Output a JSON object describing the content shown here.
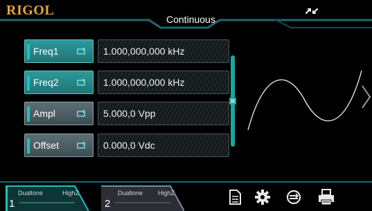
{
  "header": {
    "logo": "RIGOL",
    "mode": "Continuous",
    "sync_icon": "link-sync-icon"
  },
  "params": [
    {
      "label": "Freq1",
      "value": "1.000,000,000 kHz",
      "active": true
    },
    {
      "label": "Freq2",
      "value": "1.000,000,000 kHz",
      "active": true
    },
    {
      "label": "Ampl",
      "value": "5.000,0 Vpp",
      "active": false
    },
    {
      "label": "Offset",
      "value": "0.000,0 Vdc",
      "active": false
    }
  ],
  "channels": [
    {
      "number": "1",
      "mode": "Dualtone",
      "impedance": "HighZ",
      "color": "#1ec4c0"
    },
    {
      "number": "2",
      "mode": "Dualtone",
      "impedance": "HighZ",
      "color": "#7f8aa0"
    }
  ],
  "toolbar": {
    "icons": [
      "document-icon",
      "gear-icon",
      "sync-icon",
      "printer-icon"
    ]
  },
  "colors": {
    "accent": "#1ec4c0",
    "logo": "#e8a43a",
    "frame": "#1e5f66"
  }
}
